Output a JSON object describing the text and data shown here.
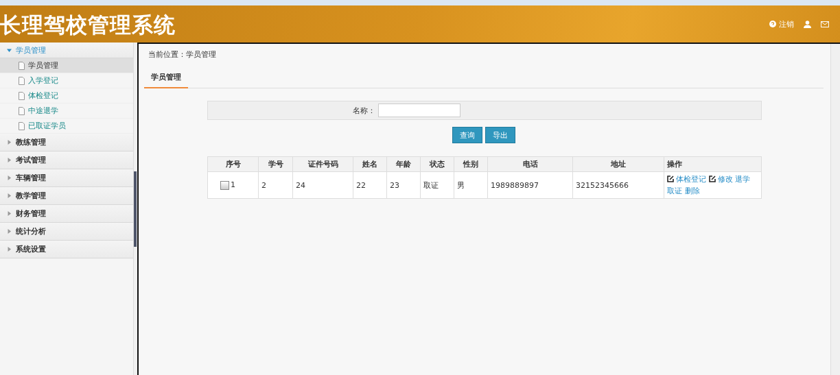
{
  "header": {
    "title": "长理驾校管理系统",
    "logout": "注销"
  },
  "sidebar": {
    "groups": [
      {
        "label": "学员管理",
        "expanded": true,
        "children": [
          {
            "label": "学员管理",
            "selected": true
          },
          {
            "label": "入学登记",
            "selected": false
          },
          {
            "label": "体检登记",
            "selected": false
          },
          {
            "label": "中途退学",
            "selected": false
          },
          {
            "label": "已取证学员",
            "selected": false
          }
        ]
      },
      {
        "label": "教练管理",
        "expanded": false
      },
      {
        "label": "考试管理",
        "expanded": false
      },
      {
        "label": "车辆管理",
        "expanded": false
      },
      {
        "label": "教学管理",
        "expanded": false
      },
      {
        "label": "财务管理",
        "expanded": false
      },
      {
        "label": "统计分析",
        "expanded": false
      },
      {
        "label": "系统设置",
        "expanded": false
      }
    ]
  },
  "breadcrumb": "当前位置：学员管理",
  "tabs": [
    {
      "label": "学员管理",
      "selected": true
    }
  ],
  "search": {
    "label": "名称：",
    "buttons": [
      "查询",
      "导出"
    ]
  },
  "table": {
    "columns": [
      "序号",
      "学号",
      "证件号码",
      "姓名",
      "年龄",
      "状态",
      "性别",
      "电话",
      "地址",
      "操作"
    ],
    "rows": [
      {
        "checked": false,
        "cells": [
          "1",
          "2",
          "24",
          "22",
          "23",
          "取证",
          "男",
          "1989889897",
          "32152345666"
        ],
        "actions": [
          {
            "label": "体检登记",
            "kind": "edit"
          },
          {
            "label": "修改",
            "kind": "edit"
          },
          {
            "label": "退学",
            "kind": "link"
          },
          {
            "label": "取证",
            "kind": "link"
          },
          {
            "label": "删除",
            "kind": "link"
          }
        ]
      }
    ]
  }
}
